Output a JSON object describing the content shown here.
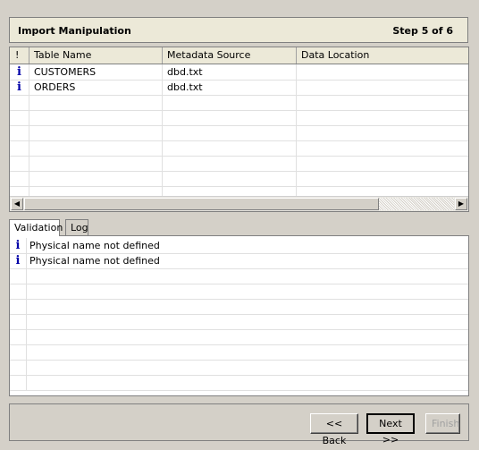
{
  "header": {
    "title": "Import Manipulation",
    "step": "Step 5 of 6"
  },
  "table": {
    "columns": [
      "!",
      "Table Name",
      "Metadata Source",
      "Data Location"
    ],
    "rows": [
      {
        "icon": "info-icon",
        "name": "CUSTOMERS",
        "source": "dbd.txt",
        "location": ""
      },
      {
        "icon": "info-icon",
        "name": "ORDERS",
        "source": "dbd.txt",
        "location": ""
      }
    ]
  },
  "tabs": [
    "Validation",
    "Log"
  ],
  "validation": [
    {
      "icon": "info-icon",
      "message": "Physical name not defined"
    },
    {
      "icon": "info-icon",
      "message": "Physical name not defined"
    }
  ],
  "buttons": {
    "back": "<< Back",
    "next": "Next >>",
    "finish": "Finish"
  },
  "info_glyph": "i",
  "colors": {
    "info_icon": "#0000a8",
    "background": "#d4d0c8"
  }
}
